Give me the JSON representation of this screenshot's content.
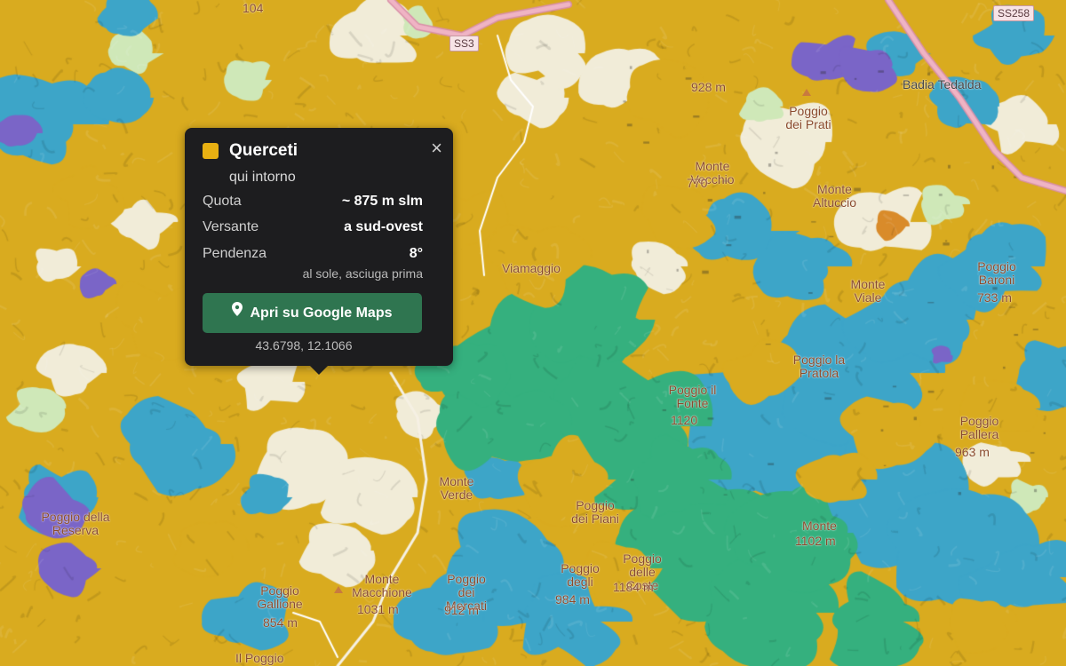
{
  "map": {
    "colors": {
      "oak": "#d9ab1f",
      "chestnut": "#3da5c8",
      "beech": "#35b07e",
      "conifer": "#7a65c7",
      "meadow": "#f1ecd8",
      "shrub": "#cfe8b8",
      "road": "#efb4c4",
      "orange_patch": "#d98b2a"
    },
    "labels": [
      "104",
      "SS258",
      "SS3",
      "928 m",
      "Badia Tedalda",
      "Poggio dei Prati",
      "Monte Vecchio",
      "770",
      "Monte Altuccio",
      "Viamaggio",
      "Monte Viale",
      "Poggio Baroni",
      "733 m",
      "Poggio il Fonte",
      "1120",
      "Poggio la Pratola",
      "Poggio Pallera",
      "963 m",
      "Monte Verde",
      "Poggio della Reserva",
      "Poggio dei Piani",
      "Monte",
      "1102 m",
      "Poggio delle Coste",
      "1184 m",
      "Poggio degli",
      "984 m",
      "Monte Macchione",
      "1031 m",
      "Poggio Gallione",
      "854 m",
      "Il Poggio",
      "Poggio dei Mercati",
      "912 m"
    ]
  },
  "popup": {
    "title": "Querceti",
    "subtitle": "qui intorno",
    "close_label": "×",
    "rows": [
      {
        "key": "Quota",
        "value": "~ 875 m slm"
      },
      {
        "key": "Versante",
        "value": "a sud-ovest"
      },
      {
        "key": "Pendenza",
        "value": "8°"
      }
    ],
    "note": "al sole, asciuga prima",
    "button_label": "Apri su Google Maps",
    "coords": "43.6798, 12.1066",
    "swatch_color": "#e8b012",
    "button_color": "#2f7550",
    "icons": {
      "close": "close-icon",
      "pin": "map-pin-icon"
    }
  }
}
